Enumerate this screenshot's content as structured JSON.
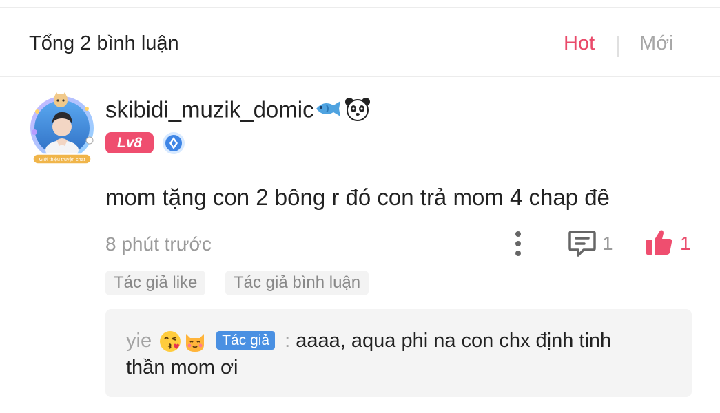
{
  "header": {
    "title": "Tổng 2 bình luận",
    "sort_hot": "Hot",
    "sort_new": "Mới"
  },
  "comment": {
    "username": "skibidi_muzik_domic",
    "username_emoji": [
      "fish-icon",
      "panda-icon"
    ],
    "level": "Lv8",
    "avatar_frame_text": "Giới thiệu truyện chat",
    "text": "mom tặng con 2 bông r đó con trả mom 4 chap đê",
    "time": "8 phút trước",
    "reply_count": "1",
    "like_count": "1",
    "tags": [
      "Tác giả like",
      "Tác giả bình luận"
    ],
    "reply": {
      "author": "yie",
      "author_emoji": [
        "kissing-face-icon",
        "cat-face-icon"
      ],
      "author_badge": "Tác giả",
      "separator": ":",
      "text_line1": "aaaa, aqua phi na con chx định tinh",
      "text_line2": "thần mom ơi"
    }
  },
  "colors": {
    "accent": "#e94a6a",
    "level_badge": "#ef4e6f",
    "author_badge": "#4a90e2",
    "muted": "#9a9a9a"
  }
}
